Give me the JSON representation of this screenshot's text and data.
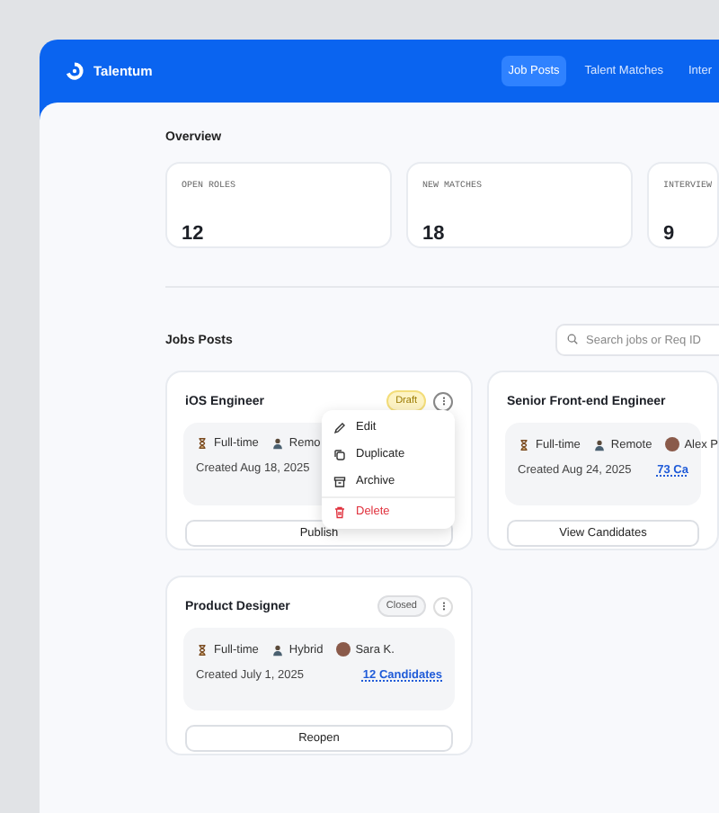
{
  "app": {
    "name": "Talentum"
  },
  "nav_tabs": [
    {
      "label": "Job Posts",
      "selected": true
    },
    {
      "label": "Talent Matches",
      "selected": false
    },
    {
      "label": "Inter",
      "selected": false
    }
  ],
  "overview": {
    "title": "Overview",
    "stats": [
      {
        "label": "OPEN ROLES",
        "value": "12"
      },
      {
        "label": "NEW MATCHES",
        "value": "18"
      },
      {
        "label": "INTERVIEW",
        "value": "9"
      }
    ]
  },
  "jobs": {
    "title": "Jobs Posts",
    "search": {
      "placeholder": "Search jobs or Req ID"
    },
    "cards": [
      {
        "title": "iOS Engineer",
        "status": {
          "label": "Draft",
          "kind": "draft"
        },
        "menu_open": true,
        "type": "Full-time",
        "location": "Remo",
        "created": "Created Aug 18, 2025",
        "action": "Publish"
      },
      {
        "title": "Senior Front-end Engineer",
        "menu_open": false,
        "type": "Full-time",
        "location": "Remote",
        "owner": "Alex P",
        "created": "Created Aug 24, 2025",
        "candidates": "73 Ca",
        "action": "View Candidates"
      },
      {
        "title": "Product Designer",
        "status": {
          "label": "Closed",
          "kind": "closed"
        },
        "menu_open": false,
        "type": "Full-time",
        "location": "Hybrid",
        "owner": "Sara K.",
        "created": "Created July 1, 2025",
        "candidates": "12 Candidates",
        "action": "Reopen"
      }
    ]
  },
  "menu": {
    "items": [
      {
        "label": "Edit",
        "kind": "edit"
      },
      {
        "label": "Duplicate",
        "kind": "duplicate"
      },
      {
        "label": "Archive",
        "kind": "archive"
      },
      {
        "label": "Delete",
        "kind": "delete"
      }
    ]
  }
}
